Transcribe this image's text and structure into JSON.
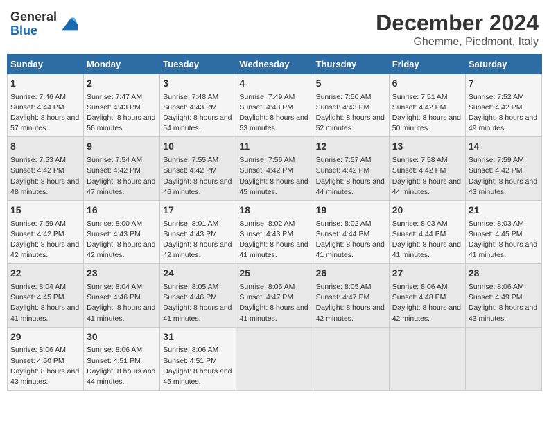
{
  "header": {
    "logo_general": "General",
    "logo_blue": "Blue",
    "month": "December 2024",
    "location": "Ghemme, Piedmont, Italy"
  },
  "weekdays": [
    "Sunday",
    "Monday",
    "Tuesday",
    "Wednesday",
    "Thursday",
    "Friday",
    "Saturday"
  ],
  "weeks": [
    [
      {
        "day": "1",
        "sunrise": "7:46 AM",
        "sunset": "4:44 PM",
        "daylight": "8 hours and 57 minutes."
      },
      {
        "day": "2",
        "sunrise": "7:47 AM",
        "sunset": "4:43 PM",
        "daylight": "8 hours and 56 minutes."
      },
      {
        "day": "3",
        "sunrise": "7:48 AM",
        "sunset": "4:43 PM",
        "daylight": "8 hours and 54 minutes."
      },
      {
        "day": "4",
        "sunrise": "7:49 AM",
        "sunset": "4:43 PM",
        "daylight": "8 hours and 53 minutes."
      },
      {
        "day": "5",
        "sunrise": "7:50 AM",
        "sunset": "4:43 PM",
        "daylight": "8 hours and 52 minutes."
      },
      {
        "day": "6",
        "sunrise": "7:51 AM",
        "sunset": "4:42 PM",
        "daylight": "8 hours and 50 minutes."
      },
      {
        "day": "7",
        "sunrise": "7:52 AM",
        "sunset": "4:42 PM",
        "daylight": "8 hours and 49 minutes."
      }
    ],
    [
      {
        "day": "8",
        "sunrise": "7:53 AM",
        "sunset": "4:42 PM",
        "daylight": "8 hours and 48 minutes."
      },
      {
        "day": "9",
        "sunrise": "7:54 AM",
        "sunset": "4:42 PM",
        "daylight": "8 hours and 47 minutes."
      },
      {
        "day": "10",
        "sunrise": "7:55 AM",
        "sunset": "4:42 PM",
        "daylight": "8 hours and 46 minutes."
      },
      {
        "day": "11",
        "sunrise": "7:56 AM",
        "sunset": "4:42 PM",
        "daylight": "8 hours and 45 minutes."
      },
      {
        "day": "12",
        "sunrise": "7:57 AM",
        "sunset": "4:42 PM",
        "daylight": "8 hours and 44 minutes."
      },
      {
        "day": "13",
        "sunrise": "7:58 AM",
        "sunset": "4:42 PM",
        "daylight": "8 hours and 44 minutes."
      },
      {
        "day": "14",
        "sunrise": "7:59 AM",
        "sunset": "4:42 PM",
        "daylight": "8 hours and 43 minutes."
      }
    ],
    [
      {
        "day": "15",
        "sunrise": "7:59 AM",
        "sunset": "4:42 PM",
        "daylight": "8 hours and 42 minutes."
      },
      {
        "day": "16",
        "sunrise": "8:00 AM",
        "sunset": "4:43 PM",
        "daylight": "8 hours and 42 minutes."
      },
      {
        "day": "17",
        "sunrise": "8:01 AM",
        "sunset": "4:43 PM",
        "daylight": "8 hours and 42 minutes."
      },
      {
        "day": "18",
        "sunrise": "8:02 AM",
        "sunset": "4:43 PM",
        "daylight": "8 hours and 41 minutes."
      },
      {
        "day": "19",
        "sunrise": "8:02 AM",
        "sunset": "4:44 PM",
        "daylight": "8 hours and 41 minutes."
      },
      {
        "day": "20",
        "sunrise": "8:03 AM",
        "sunset": "4:44 PM",
        "daylight": "8 hours and 41 minutes."
      },
      {
        "day": "21",
        "sunrise": "8:03 AM",
        "sunset": "4:45 PM",
        "daylight": "8 hours and 41 minutes."
      }
    ],
    [
      {
        "day": "22",
        "sunrise": "8:04 AM",
        "sunset": "4:45 PM",
        "daylight": "8 hours and 41 minutes."
      },
      {
        "day": "23",
        "sunrise": "8:04 AM",
        "sunset": "4:46 PM",
        "daylight": "8 hours and 41 minutes."
      },
      {
        "day": "24",
        "sunrise": "8:05 AM",
        "sunset": "4:46 PM",
        "daylight": "8 hours and 41 minutes."
      },
      {
        "day": "25",
        "sunrise": "8:05 AM",
        "sunset": "4:47 PM",
        "daylight": "8 hours and 41 minutes."
      },
      {
        "day": "26",
        "sunrise": "8:05 AM",
        "sunset": "4:47 PM",
        "daylight": "8 hours and 42 minutes."
      },
      {
        "day": "27",
        "sunrise": "8:06 AM",
        "sunset": "4:48 PM",
        "daylight": "8 hours and 42 minutes."
      },
      {
        "day": "28",
        "sunrise": "8:06 AM",
        "sunset": "4:49 PM",
        "daylight": "8 hours and 43 minutes."
      }
    ],
    [
      {
        "day": "29",
        "sunrise": "8:06 AM",
        "sunset": "4:50 PM",
        "daylight": "8 hours and 43 minutes."
      },
      {
        "day": "30",
        "sunrise": "8:06 AM",
        "sunset": "4:51 PM",
        "daylight": "8 hours and 44 minutes."
      },
      {
        "day": "31",
        "sunrise": "8:06 AM",
        "sunset": "4:51 PM",
        "daylight": "8 hours and 45 minutes."
      },
      null,
      null,
      null,
      null
    ]
  ],
  "labels": {
    "sunrise": "Sunrise:",
    "sunset": "Sunset:",
    "daylight": "Daylight:"
  }
}
